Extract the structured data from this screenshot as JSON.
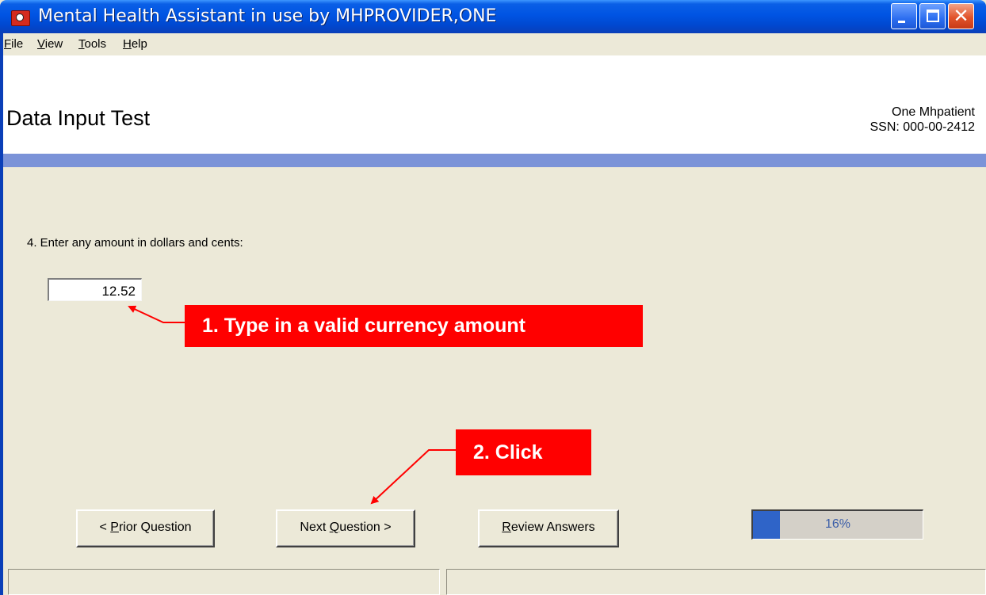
{
  "window": {
    "title": "Mental Health Assistant in use by MHPROVIDER,ONE",
    "icons": {
      "app": "app-logo-icon",
      "minimize": "minimize-icon",
      "maximize": "maximize-icon",
      "close": "close-icon"
    },
    "close_glyph": "✕"
  },
  "menu": {
    "items": [
      {
        "label_underlined": "F",
        "label_rest": "ile"
      },
      {
        "label_underlined": "V",
        "label_rest": "iew"
      },
      {
        "label_underlined": "T",
        "label_rest": "ools"
      },
      {
        "label_underlined": "H",
        "label_rest": "elp"
      }
    ]
  },
  "header": {
    "title": "Data Input Test",
    "patient_name": "One Mhpatient",
    "patient_ssn": "SSN: 000-00-2412"
  },
  "question": {
    "text": "4. Enter any amount in dollars and cents:",
    "value": "12.52"
  },
  "callouts": {
    "step1": "1. Type in a valid currency amount",
    "step2": "2. Click"
  },
  "buttons": {
    "prior_prefix": "< ",
    "prior_underlined": "P",
    "prior_rest": "rior Question",
    "next_prefix": "Next ",
    "next_underlined": "Q",
    "next_rest": "uestion >",
    "review_underlined": "R",
    "review_rest": "eview Answers"
  },
  "progress": {
    "percent": 16,
    "label": "16%"
  },
  "colors": {
    "accent_bar": "#7b93d8",
    "callout": "#ff0000",
    "progress_fill": "#2f64c8"
  }
}
